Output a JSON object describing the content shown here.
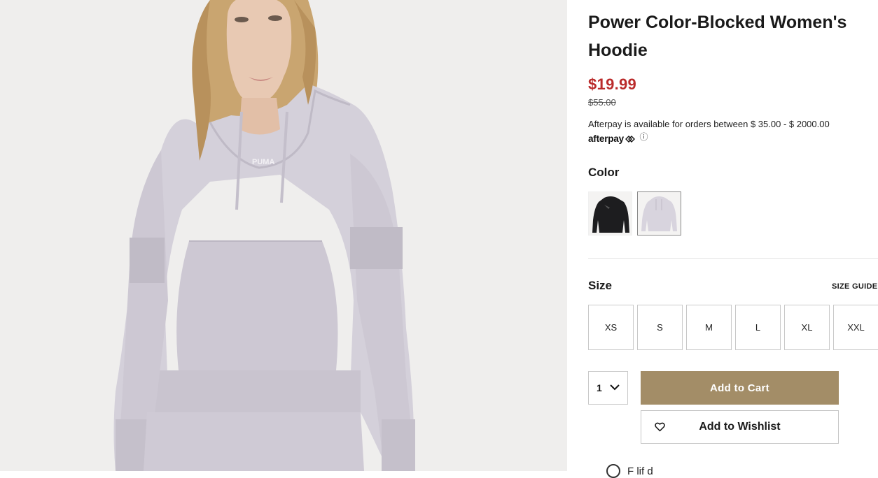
{
  "product": {
    "title": "Power Color-Blocked Women's Hoodie",
    "sale_price": "$19.99",
    "original_price": "$55.00",
    "image_alt_icon": "product-photo-hoodie-model"
  },
  "afterpay": {
    "text": "Afterpay is available for orders between $ 35.00 - $ 2000.00",
    "logo": "afterpay",
    "info_icon": "ⓘ"
  },
  "color": {
    "label": "Color",
    "swatches": [
      {
        "name": "black",
        "selected": false
      },
      {
        "name": "lilac",
        "selected": true
      }
    ]
  },
  "size": {
    "label": "Size",
    "guide_label": "SIZE GUIDE",
    "options": [
      "XS",
      "S",
      "M",
      "L",
      "XL",
      "XXL"
    ]
  },
  "purchase": {
    "quantity": "1",
    "add_to_cart": "Add to Cart",
    "add_to_wishlist": "Add to Wishlist"
  },
  "footer_peek": {
    "text": "F                     lif         d"
  },
  "colors": {
    "sale_price": "#ba2b2b",
    "cart_button": "#a38d67",
    "hoodie": "#d4d0da"
  }
}
